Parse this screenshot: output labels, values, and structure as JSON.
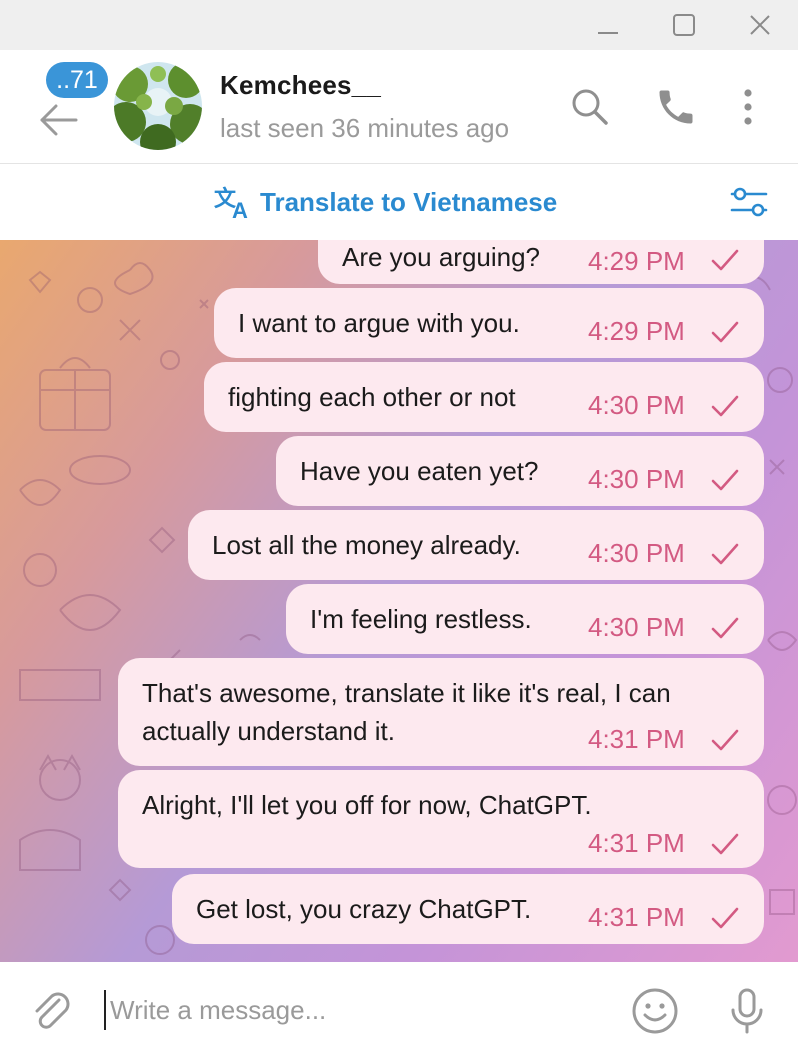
{
  "window": {
    "controls": [
      "minimize-icon",
      "maximize-icon",
      "close-icon"
    ]
  },
  "header": {
    "unread_badge": "..71",
    "contact_name": "Kemchees__",
    "status": "last seen 36 minutes ago",
    "icons": [
      "back-arrow-icon",
      "search-icon",
      "phone-icon",
      "more-vertical-icon"
    ]
  },
  "translate_bar": {
    "label": "Translate to Vietnamese",
    "icons": [
      "translate-icon",
      "settings-sliders-icon"
    ]
  },
  "messages": [
    {
      "text": "Are you arguing?",
      "time": "4:29 PM",
      "status": "sent"
    },
    {
      "text": "I want to argue with you.",
      "time": "4:29 PM",
      "status": "sent"
    },
    {
      "text": "fighting each other or not",
      "time": "4:30 PM",
      "status": "sent"
    },
    {
      "text": "Have you eaten yet?",
      "time": "4:30 PM",
      "status": "sent"
    },
    {
      "text": "Lost all the money already.",
      "time": "4:30 PM",
      "status": "sent"
    },
    {
      "text": "I'm feeling restless.",
      "time": "4:30 PM",
      "status": "sent"
    },
    {
      "text_line1": "That's awesome, translate it like it's real, I can",
      "text_line2": "actually understand it.",
      "time": "4:31 PM",
      "status": "sent"
    },
    {
      "text": "Alright, I'll let you off for now, ChatGPT.",
      "time": "4:31 PM",
      "status": "sent"
    },
    {
      "text": "Get lost, you crazy ChatGPT.",
      "time": "4:31 PM",
      "status": "sent"
    }
  ],
  "composer": {
    "placeholder": "Write a message...",
    "value": "",
    "icons": [
      "attach-icon",
      "emoji-icon",
      "microphone-icon"
    ]
  },
  "colors": {
    "accent": "#2a8ad0",
    "badge": "#3a95d8",
    "bubble": "#fde9ef",
    "time_text": "#d35a82"
  }
}
